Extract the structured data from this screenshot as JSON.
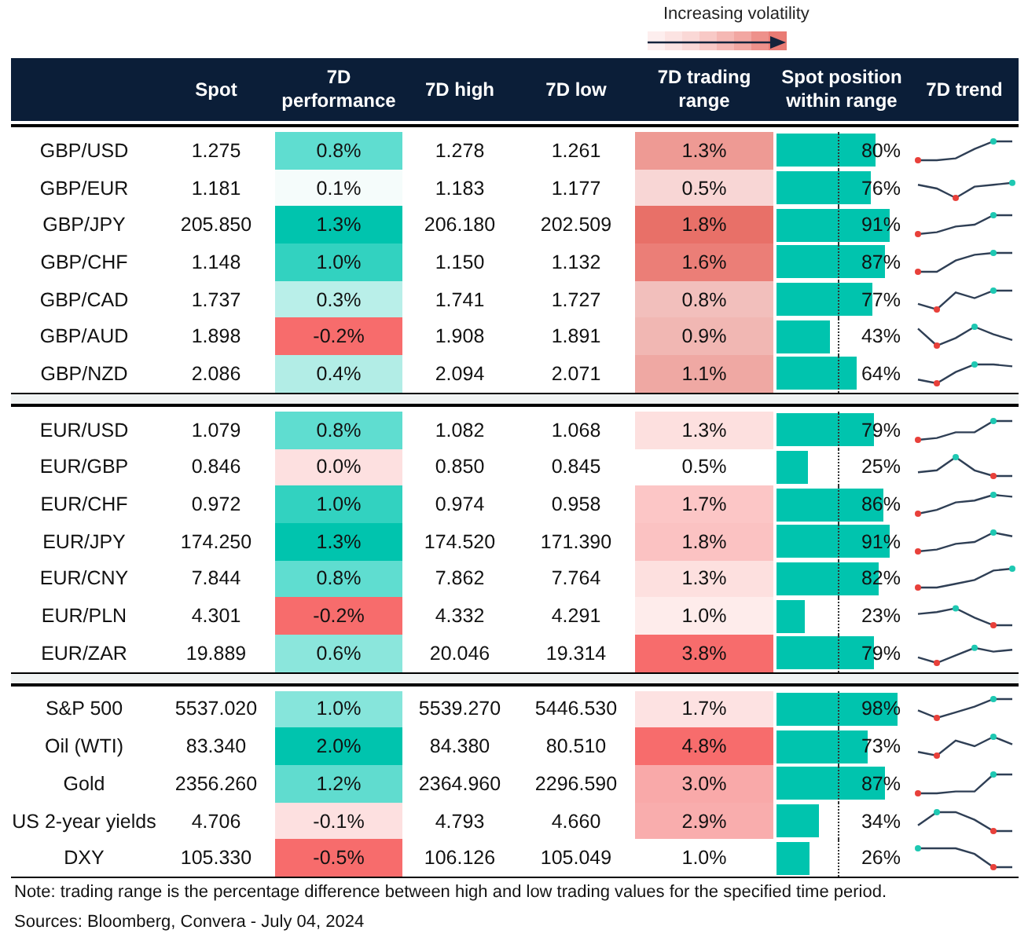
{
  "legend": {
    "label": "Increasing volatility"
  },
  "columns": [
    "Spot",
    "7D performance",
    "7D high",
    "7D low",
    "7D trading range",
    "Spot position within range",
    "7D trend"
  ],
  "groups": [
    {
      "rows": [
        {
          "name": "GBP/USD",
          "spot": "1.275",
          "performance": {
            "text": "0.8%",
            "color": "#5fddd0"
          },
          "high": "1.278",
          "low": "1.261",
          "range": {
            "text": "1.3%",
            "color": "#ee9a94"
          },
          "position": {
            "text": "80%",
            "level": 0.8
          }
        },
        {
          "name": "GBP/EUR",
          "spot": "1.181",
          "performance": {
            "text": "0.1%",
            "color": "#f5fcfb"
          },
          "high": "1.183",
          "low": "1.177",
          "range": {
            "text": "0.5%",
            "color": "#f8d6d5"
          },
          "position": {
            "text": "76%",
            "level": 0.76
          }
        },
        {
          "name": "GBP/JPY",
          "spot": "205.850",
          "performance": {
            "text": "1.3%",
            "color": "#00c4ae"
          },
          "high": "206.180",
          "low": "202.509",
          "range": {
            "text": "1.8%",
            "color": "#e87068"
          },
          "position": {
            "text": "91%",
            "level": 0.91
          }
        },
        {
          "name": "GBP/CHF",
          "spot": "1.148",
          "performance": {
            "text": "1.0%",
            "color": "#32d2c0"
          },
          "high": "1.150",
          "low": "1.132",
          "range": {
            "text": "1.6%",
            "color": "#eb7e77"
          },
          "position": {
            "text": "87%",
            "level": 0.87
          }
        },
        {
          "name": "GBP/CAD",
          "spot": "1.737",
          "performance": {
            "text": "0.3%",
            "color": "#b9efe9"
          },
          "high": "1.741",
          "low": "1.727",
          "range": {
            "text": "0.8%",
            "color": "#f2bfbc"
          },
          "position": {
            "text": "77%",
            "level": 0.77
          }
        },
        {
          "name": "GBP/AUD",
          "spot": "1.898",
          "performance": {
            "text": "-0.2%",
            "color": "#f76c6c"
          },
          "high": "1.908",
          "low": "1.891",
          "range": {
            "text": "0.9%",
            "color": "#f1b7b3"
          },
          "position": {
            "text": "43%",
            "level": 0.43
          }
        },
        {
          "name": "GBP/NZD",
          "spot": "2.086",
          "performance": {
            "text": "0.4%",
            "color": "#b2ede6"
          },
          "high": "2.094",
          "low": "2.071",
          "range": {
            "text": "1.1%",
            "color": "#efa8a3"
          },
          "position": {
            "text": "64%",
            "level": 0.64
          }
        }
      ]
    },
    {
      "rows": [
        {
          "name": "EUR/USD",
          "spot": "1.079",
          "performance": {
            "text": "0.8%",
            "color": "#5fddd0"
          },
          "high": "1.082",
          "low": "1.068",
          "range": {
            "text": "1.3%",
            "color": "#fde0df"
          },
          "position": {
            "text": "79%",
            "level": 0.79
          }
        },
        {
          "name": "EUR/GBP",
          "spot": "0.846",
          "performance": {
            "text": "0.0%",
            "color": "#fde0e0"
          },
          "high": "0.850",
          "low": "0.845",
          "range": {
            "text": "0.5%",
            "color": "#ffffff"
          },
          "position": {
            "text": "25%",
            "level": 0.25
          }
        },
        {
          "name": "EUR/CHF",
          "spot": "0.972",
          "performance": {
            "text": "1.0%",
            "color": "#32d2c0"
          },
          "high": "0.974",
          "low": "0.958",
          "range": {
            "text": "1.7%",
            "color": "#fcc6c6"
          },
          "position": {
            "text": "86%",
            "level": 0.86
          }
        },
        {
          "name": "EUR/JPY",
          "spot": "174.250",
          "performance": {
            "text": "1.3%",
            "color": "#00c4ae"
          },
          "high": "174.520",
          "low": "171.390",
          "range": {
            "text": "1.8%",
            "color": "#fbc2c2"
          },
          "position": {
            "text": "91%",
            "level": 0.91
          }
        },
        {
          "name": "EUR/CNY",
          "spot": "7.844",
          "performance": {
            "text": "0.8%",
            "color": "#5fddd0"
          },
          "high": "7.862",
          "low": "7.764",
          "range": {
            "text": "1.3%",
            "color": "#fde0df"
          },
          "position": {
            "text": "82%",
            "level": 0.82
          }
        },
        {
          "name": "EUR/PLN",
          "spot": "4.301",
          "performance": {
            "text": "-0.2%",
            "color": "#f76c6c"
          },
          "high": "4.332",
          "low": "4.291",
          "range": {
            "text": "1.0%",
            "color": "#feeceb"
          },
          "position": {
            "text": "23%",
            "level": 0.23
          }
        },
        {
          "name": "EUR/ZAR",
          "spot": "19.889",
          "performance": {
            "text": "0.6%",
            "color": "#8be6dc"
          },
          "high": "20.046",
          "low": "19.314",
          "range": {
            "text": "3.8%",
            "color": "#f76c6c"
          },
          "position": {
            "text": "79%",
            "level": 0.79
          }
        }
      ]
    },
    {
      "rows": [
        {
          "name": "S&P 500",
          "spot": "5537.020",
          "performance": {
            "text": "1.0%",
            "color": "#86e5db"
          },
          "high": "5539.270",
          "low": "5446.530",
          "range": {
            "text": "1.7%",
            "color": "#fde2e2"
          },
          "position": {
            "text": "98%",
            "level": 0.98
          }
        },
        {
          "name": "Oil (WTI)",
          "spot": "83.340",
          "performance": {
            "text": "2.0%",
            "color": "#00c4ae"
          },
          "high": "84.380",
          "low": "80.510",
          "range": {
            "text": "4.8%",
            "color": "#f76c6c"
          },
          "position": {
            "text": "73%",
            "level": 0.73
          }
        },
        {
          "name": "Gold",
          "spot": "2356.260",
          "performance": {
            "text": "1.2%",
            "color": "#60dccf"
          },
          "high": "2364.960",
          "low": "2296.590",
          "range": {
            "text": "3.0%",
            "color": "#f9a9a9"
          },
          "position": {
            "text": "87%",
            "level": 0.87
          }
        },
        {
          "name": "US 2-year yields",
          "spot": "4.706",
          "performance": {
            "text": "-0.1%",
            "color": "#fde0e0"
          },
          "high": "4.793",
          "low": "4.660",
          "range": {
            "text": "2.9%",
            "color": "#f9adad"
          },
          "position": {
            "text": "34%",
            "level": 0.34
          }
        },
        {
          "name": "DXY",
          "spot": "105.330",
          "performance": {
            "text": "-0.5%",
            "color": "#f76c6c"
          },
          "high": "106.126",
          "low": "105.049",
          "range": {
            "text": "1.0%",
            "color": "#ffffff"
          },
          "position": {
            "text": "26%",
            "level": 0.26
          }
        }
      ]
    }
  ],
  "note": "Note: trading range is the percentage difference between high and low trading values for the specified time period.",
  "sources": "Sources: Bloomberg, Convera - July 04, 2024"
}
